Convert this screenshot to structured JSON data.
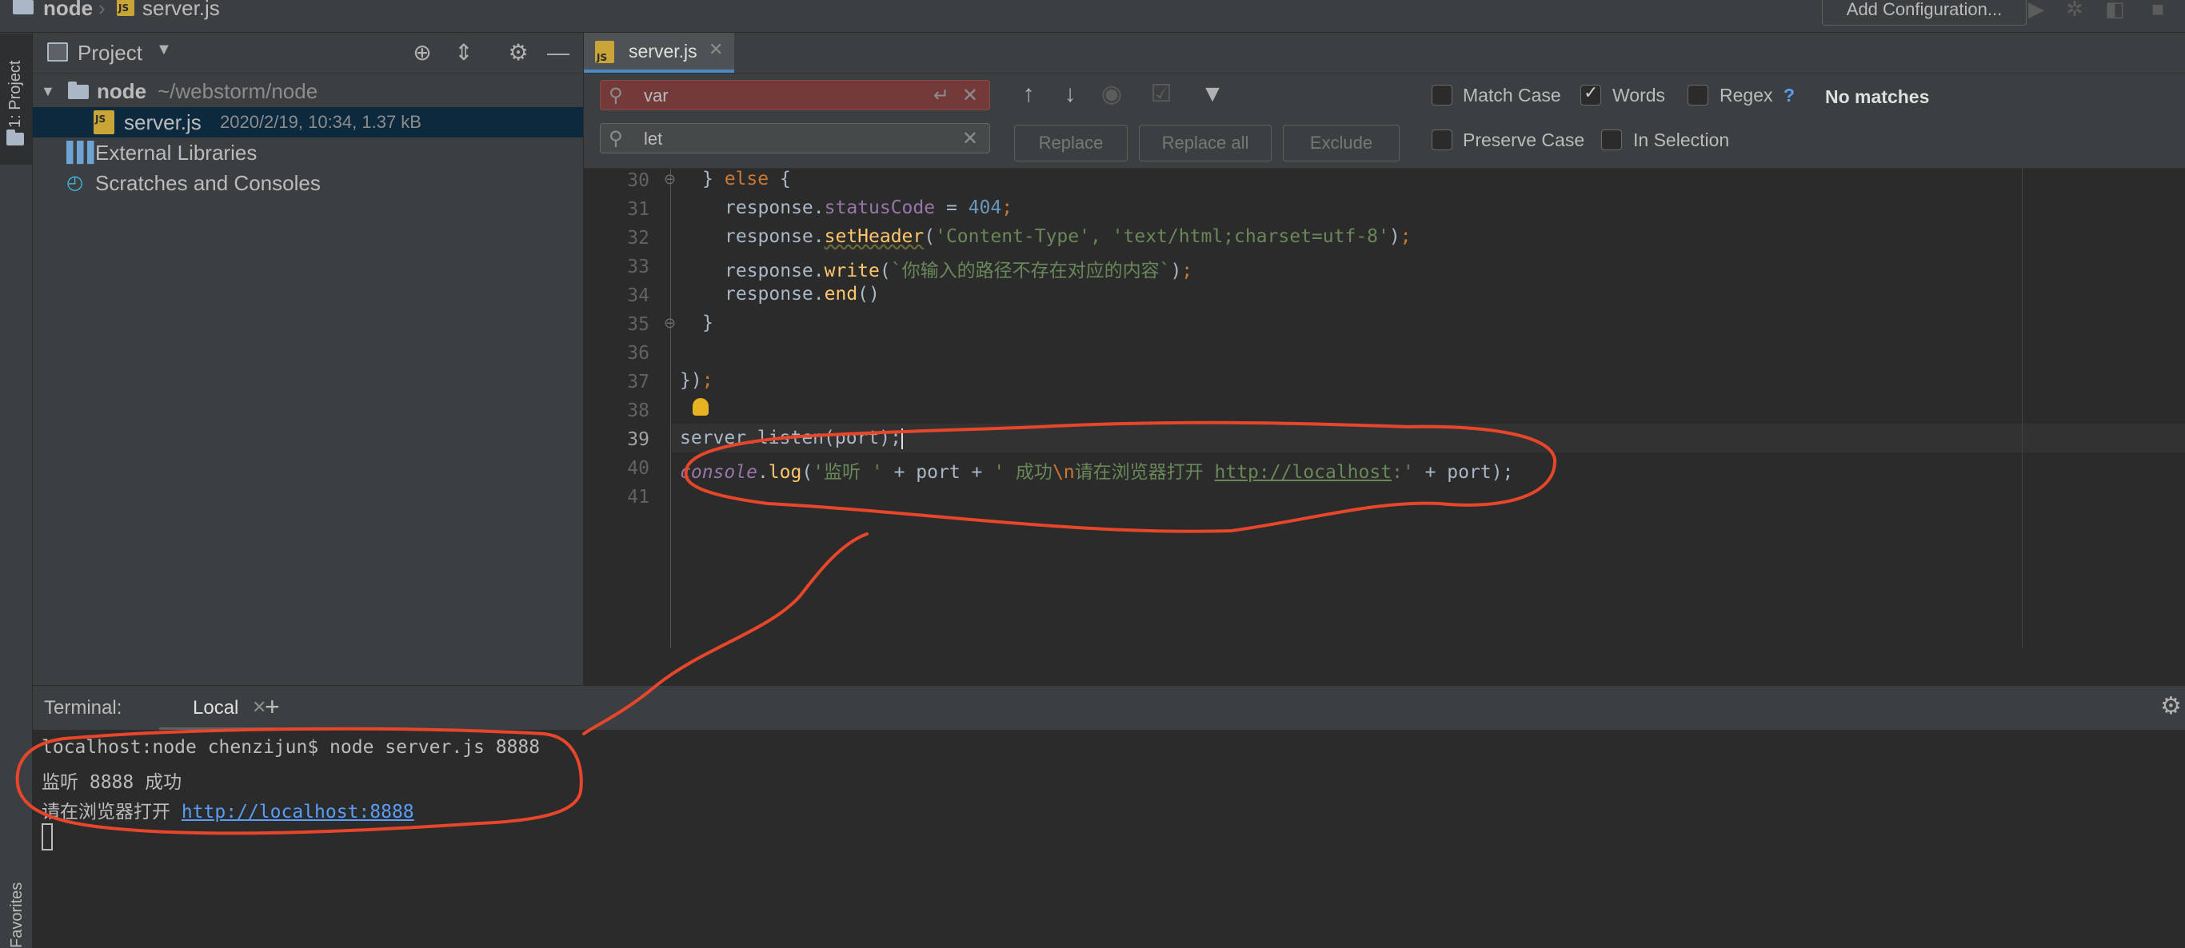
{
  "navbar": {
    "crumb_folder": "node",
    "crumb_file": "server.js",
    "add_configuration": "Add Configuration..."
  },
  "left_strip": {
    "project_tab": "1: Project",
    "favorites_tab": "Favorites"
  },
  "project_panel": {
    "title": "Project",
    "tree": {
      "root_name": "node",
      "root_path": "~/webstorm/node",
      "file_name": "server.js",
      "file_meta": "2020/2/19, 10:34, 1.37 kB",
      "external_libraries": "External Libraries",
      "scratches": "Scratches and Consoles"
    }
  },
  "editor": {
    "tab_label": "server.js",
    "find": {
      "search_value": "var",
      "replace_value": "let",
      "replace_label": "Replace",
      "replace_all_label": "Replace all",
      "exclude_label": "Exclude",
      "match_case": "Match Case",
      "words": "Words",
      "regex": "Regex",
      "regex_help": "?",
      "no_matches": "No matches",
      "preserve_case": "Preserve Case",
      "in_selection": "In Selection",
      "match_case_checked": false,
      "words_checked": true,
      "regex_checked": false,
      "preserve_case_checked": false,
      "in_selection_checked": false
    },
    "line_numbers": [
      "30",
      "31",
      "32",
      "33",
      "34",
      "35",
      "36",
      "37",
      "38",
      "39",
      "40",
      "41"
    ],
    "code": {
      "l30_else": "else",
      "l31_obj": "response.",
      "l31_prop": "statusCode",
      "l31_eq": " = ",
      "l31_num": "404",
      "l32_obj": "response.",
      "l32_fn": "setHeader",
      "l32_args": "'Content-Type', 'text/html;charset=utf-8'",
      "l33_obj": "response.",
      "l33_fn": "write",
      "l33_str": "`你输入的路径不存在对应的内容`",
      "l34_obj": "response.",
      "l34_fn": "end",
      "l39_text": "server.listen(port);",
      "l40_console": "console",
      "l40_log": "log",
      "l40_str1": "'监听 '",
      "l40_mid": " + port + ",
      "l40_str2a": "' 成功",
      "l40_esc": "\\n",
      "l40_str2b": "请在浏览器打开 ",
      "l40_link": "http://localhost",
      "l40_str2c": ":'",
      "l40_end": " + port);"
    }
  },
  "terminal": {
    "label": "Terminal:",
    "tab_local": "Local",
    "line1": "localhost:node chenzijun$ node server.js 8888",
    "line2": "监听 8888 成功",
    "line3_prefix": "请在浏览器打开 ",
    "line3_link": "http://localhost:8888"
  },
  "colors": {
    "annotation_red": "#e8462a",
    "accent_blue": "#4a88c7"
  }
}
